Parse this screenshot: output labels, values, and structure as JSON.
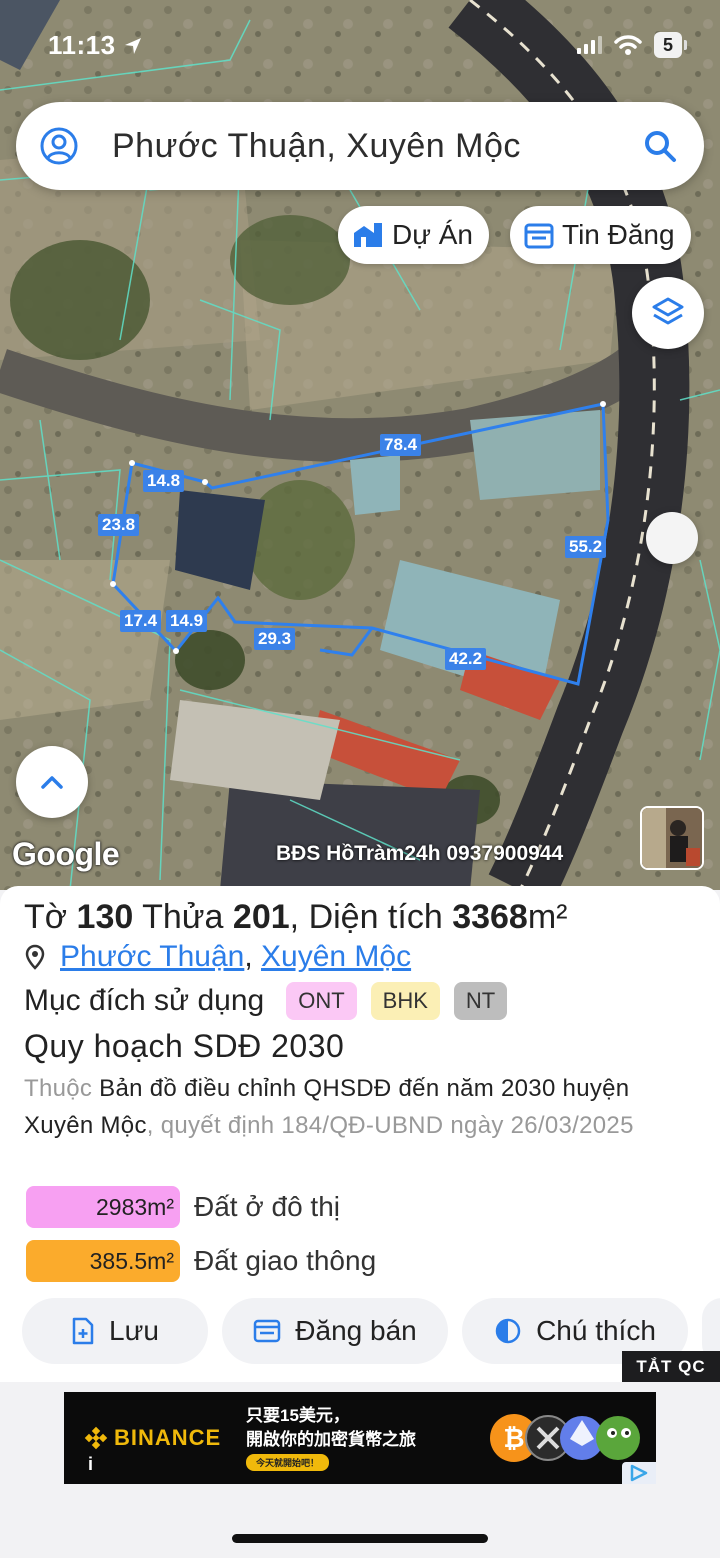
{
  "status": {
    "time": "11:13",
    "battery": "5"
  },
  "search": {
    "query": "Phước Thuận, Xuyên Mộc"
  },
  "chips": {
    "projects": "Dự Án",
    "listings": "Tin Đăng"
  },
  "map": {
    "dimensions": [
      "78.4",
      "14.8",
      "23.8",
      "55.2",
      "17.4",
      "14.9",
      "29.3",
      "42.2"
    ],
    "google_logo": "Google",
    "watermark": "BĐS HồTràm24h 0937900944"
  },
  "parcel": {
    "title_prefix": "Tờ",
    "sheet": "130",
    "lot_label": "Thửa",
    "lot": "201",
    "area_label": "Diện tích",
    "area_value": "3368",
    "area_unit": "m²",
    "commune": "Phước Thuận",
    "separator": ",",
    "district": "Xuyên Mộc",
    "purpose_label": "Mục đích sử dụng",
    "purpose_tags": [
      {
        "code": "ONT",
        "color": "#fbc8f5"
      },
      {
        "code": "BHK",
        "color": "#fbefb5"
      },
      {
        "code": "NT",
        "color": "#bdbdbd"
      }
    ],
    "planning_title": "Quy hoạch SDĐ 2030",
    "planning_prefix": "Thuộc",
    "planning_map": "Bản đồ điều chỉnh QHSDĐ đến năm 2030 huyện Xuyên Mộc",
    "planning_decision": ", quyết định 184/QĐ-UBND ngày 26/03/2025",
    "areas": [
      {
        "value": "2983m²",
        "label": "Đất ở đô thị",
        "color": "#f7a0f2"
      },
      {
        "value": "385.5m²",
        "label": "Đất giao thông",
        "color": "#fbab2c"
      }
    ]
  },
  "actions": {
    "save": "Lưu",
    "post": "Đăng bán",
    "legend": "Chú thích"
  },
  "ad": {
    "close_label": "TẮT QC",
    "brand": "BINANCE",
    "line1": "只要15美元，",
    "line2": "開啟你的加密貨幣之旅",
    "cta": "今天就開始吧！",
    "info": "i"
  },
  "colors": {
    "accent": "#2b7de9",
    "boundary": "#3b82e8",
    "panel_bg": "#ffffff"
  }
}
